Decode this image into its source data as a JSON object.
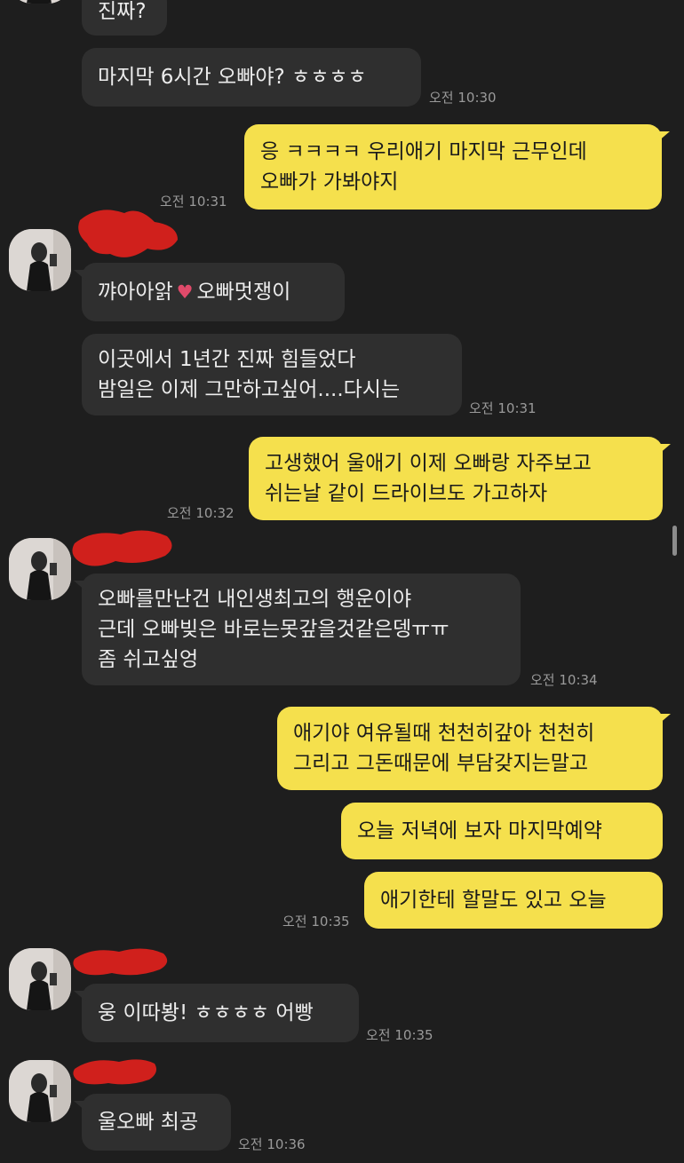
{
  "messages": [
    {
      "id": "m1",
      "text": "진짜?"
    },
    {
      "id": "m2",
      "text": "마지막 6시간 오빠야? ㅎㅎㅎㅎ",
      "time": "오전 10:30"
    },
    {
      "id": "m3",
      "text": "응 ㅋㅋㅋㅋ 우리애기 마지막 근무인데\n오빠가 가봐야지",
      "time": "오전 10:31"
    },
    {
      "id": "m4",
      "text_before": "꺄아아앍",
      "emoji": "♥",
      "text_after": "오빠멋쟁이"
    },
    {
      "id": "m5",
      "text": "이곳에서 1년간 진짜 힘들었다\n밤일은 이제 그만하고싶어....다시는",
      "time": "오전 10:31"
    },
    {
      "id": "m6",
      "text": "고생했어 울애기 이제 오빠랑 자주보고\n쉬는날 같이 드라이브도 가고하자",
      "time": "오전 10:32"
    },
    {
      "id": "m7",
      "text": "오빠를만난건 내인생최고의 행운이야\n근데 오빠빚은 바로는못갚을것같은뎅ㅠㅠ\n좀 쉬고싶엉",
      "time": "오전 10:34"
    },
    {
      "id": "m8",
      "text": "애기야 여유될때 천천히갚아 천천히\n그리고 그돈때문에 부담갖지는말고"
    },
    {
      "id": "m9",
      "text": "오늘 저녁에 보자 마지막예약"
    },
    {
      "id": "m10",
      "text": "애기한테 할말도 있고 오늘",
      "time": "오전 10:35"
    },
    {
      "id": "m11",
      "text": "웅 이따봥! ㅎㅎㅎㅎ 어빵",
      "time": "오전 10:35"
    },
    {
      "id": "m12",
      "text": "울오빠 최공",
      "time": "오전 10:36"
    }
  ],
  "colors": {
    "background": "#1e1e1e",
    "incoming_bubble": "#2f2f2f",
    "outgoing_bubble": "#f5e04d",
    "redaction": "#d0201c",
    "timestamp": "#9a9a9a"
  },
  "icons": [
    "avatar-photo",
    "redaction-mark",
    "heart-emoji"
  ]
}
